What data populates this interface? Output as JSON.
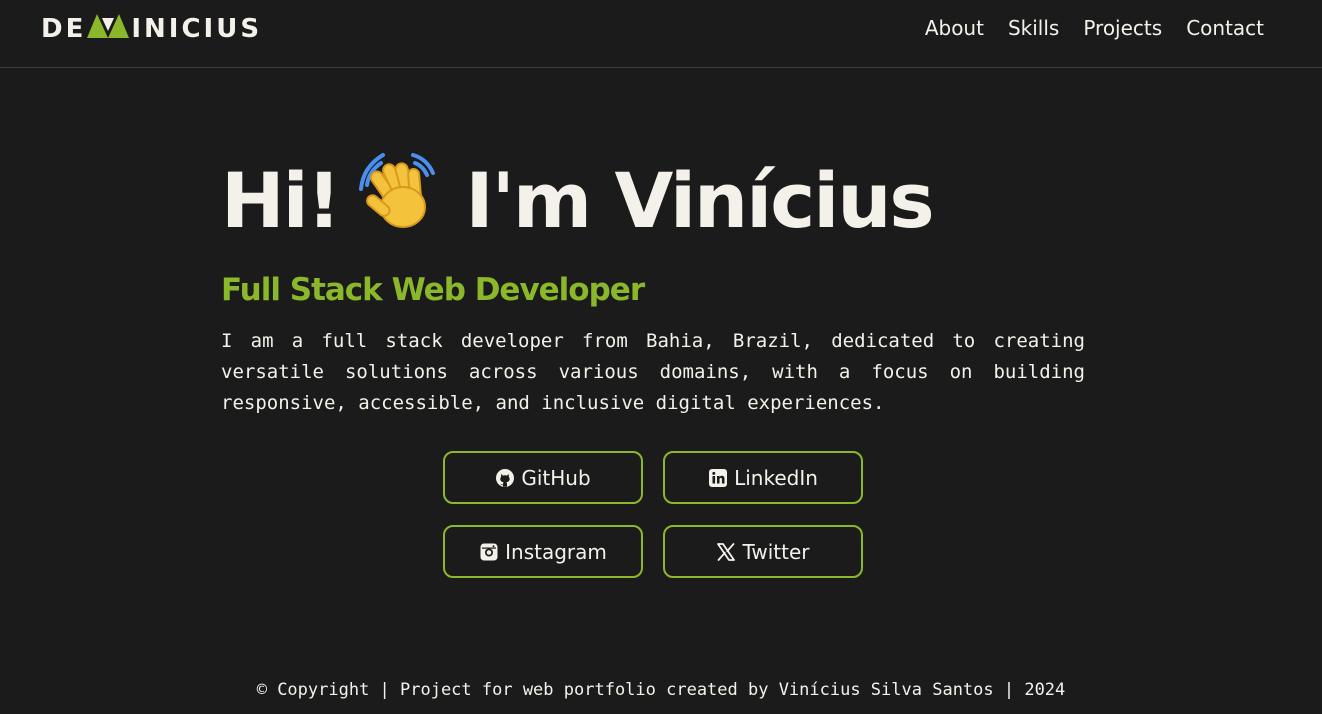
{
  "header": {
    "logo": {
      "prefix": "DE",
      "suffix": "INICIUS",
      "mark_icon": "green-triangle-v-mark",
      "colors": {
        "text": "#f3f1ea",
        "mark": "#8ab82a"
      }
    },
    "nav": [
      {
        "label": "About"
      },
      {
        "label": "Skills"
      },
      {
        "label": "Projects"
      },
      {
        "label": "Contact"
      }
    ]
  },
  "hero": {
    "greeting_before": "Hi!",
    "wave_icon": "waving-hand-icon",
    "greeting_after": "I'm Vinícius",
    "role": "Full Stack Web Developer",
    "bio": "I am a full stack developer from Bahia, Brazil, dedicated to creating versatile solutions across various domains, with a focus on building responsive, accessible, and inclusive digital experiences."
  },
  "socials": [
    {
      "label": "GitHub",
      "icon": "github-icon"
    },
    {
      "label": "LinkedIn",
      "icon": "linkedin-icon"
    },
    {
      "label": "Instagram",
      "icon": "instagram-icon"
    },
    {
      "label": "Twitter",
      "icon": "x-twitter-icon"
    }
  ],
  "footer": {
    "text": "© Copyright | Project for web portfolio created by Vinícius Silva Santos | 2024"
  },
  "colors": {
    "background": "#1b1b1b",
    "text": "#f3f1ea",
    "accent": "#8ab82a",
    "divider": "#3d3d3d",
    "wave_hand": "#f5c33b",
    "wave_motion": "#4a8ff0"
  }
}
